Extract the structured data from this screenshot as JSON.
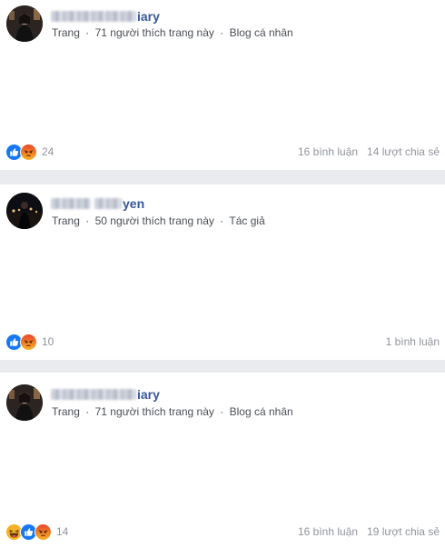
{
  "posts": [
    {
      "name_visible": "iary",
      "meta": {
        "type": "Trang",
        "likes": "71 người thích trang này",
        "category": "Blog cá nhân"
      },
      "reactions": [
        "like",
        "angry"
      ],
      "reaction_count": "24",
      "comments": "16 bình luận",
      "shares": "14 lượt chia sẻ"
    },
    {
      "name_visible": "yen",
      "meta": {
        "type": "Trang",
        "likes": "50 người thích trang này",
        "category": "Tác giả"
      },
      "reactions": [
        "like",
        "angry"
      ],
      "reaction_count": "10",
      "comments": "1 bình luận",
      "shares": ""
    },
    {
      "name_visible": "iary",
      "meta": {
        "type": "Trang",
        "likes": "71 người thích trang này",
        "category": "Blog cá nhân"
      },
      "reactions": [
        "haha",
        "like",
        "angry"
      ],
      "reaction_count": "14",
      "comments": "16 bình luận",
      "shares": "19 lượt chia sẻ"
    }
  ],
  "separator": "·",
  "icons": {
    "like": "like-icon",
    "angry": "angry-icon",
    "haha": "haha-icon"
  },
  "colors": {
    "link_blue": "#365899",
    "like_blue": "#1877f2",
    "angry_orange": "#f07832",
    "haha_yellow": "#f7b125",
    "muted": "#90949c",
    "page_bg": "#e9ebee"
  }
}
